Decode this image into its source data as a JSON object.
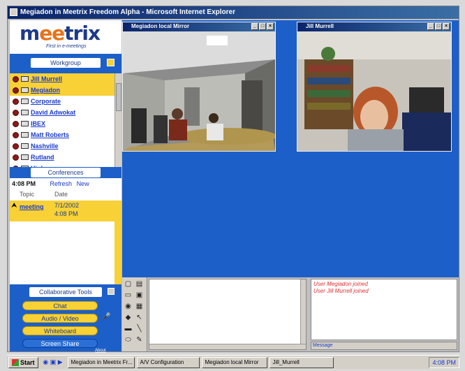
{
  "window": {
    "title": "Megiadon in Meetrix Freedom Alpha - Microsoft Internet Explorer"
  },
  "brand": {
    "logo": "meetrix",
    "tagline": "First in e-meetings"
  },
  "workgroup": {
    "header": "Workgroup",
    "members": [
      {
        "name": "Jill Murrell",
        "selected": true
      },
      {
        "name": "Megiadon",
        "selected": true
      },
      {
        "name": "Corporate",
        "selected": false
      },
      {
        "name": "David Adwokat",
        "selected": false
      },
      {
        "name": "IBEX",
        "selected": false
      },
      {
        "name": "Matt Roberts",
        "selected": false
      },
      {
        "name": "Nashville",
        "selected": false
      },
      {
        "name": "Rutland",
        "selected": false
      },
      {
        "name": "Highway",
        "selected": false
      }
    ]
  },
  "conferences": {
    "header": "Conferences",
    "time": "4:08 PM",
    "refresh": "Refresh",
    "new_label": "New",
    "col_topic": "Topic",
    "col_date": "Date",
    "rows": [
      {
        "topic": "meeting",
        "date": "7/1/2002",
        "time": "4:08 PM"
      }
    ]
  },
  "tools": {
    "header": "Collaborative Tools",
    "buttons": [
      "Chat",
      "Audio / Video",
      "Whiteboard",
      "Screen Share"
    ],
    "about": "About"
  },
  "video_windows": [
    {
      "title": "Megiadon local Mirror"
    },
    {
      "title": "Jill Murrell"
    }
  ],
  "chat": {
    "lines": [
      "User Megiadon joined",
      "User Jill Murrell joined"
    ],
    "input_label": "Message"
  },
  "taskbar": {
    "start": "Start",
    "tasks": [
      "Megiadon in Meetrix Fr...",
      "A/V Configuration",
      "Megiadon local Mirror",
      "Jill_Murrell"
    ],
    "tray": "4:08 PM"
  }
}
